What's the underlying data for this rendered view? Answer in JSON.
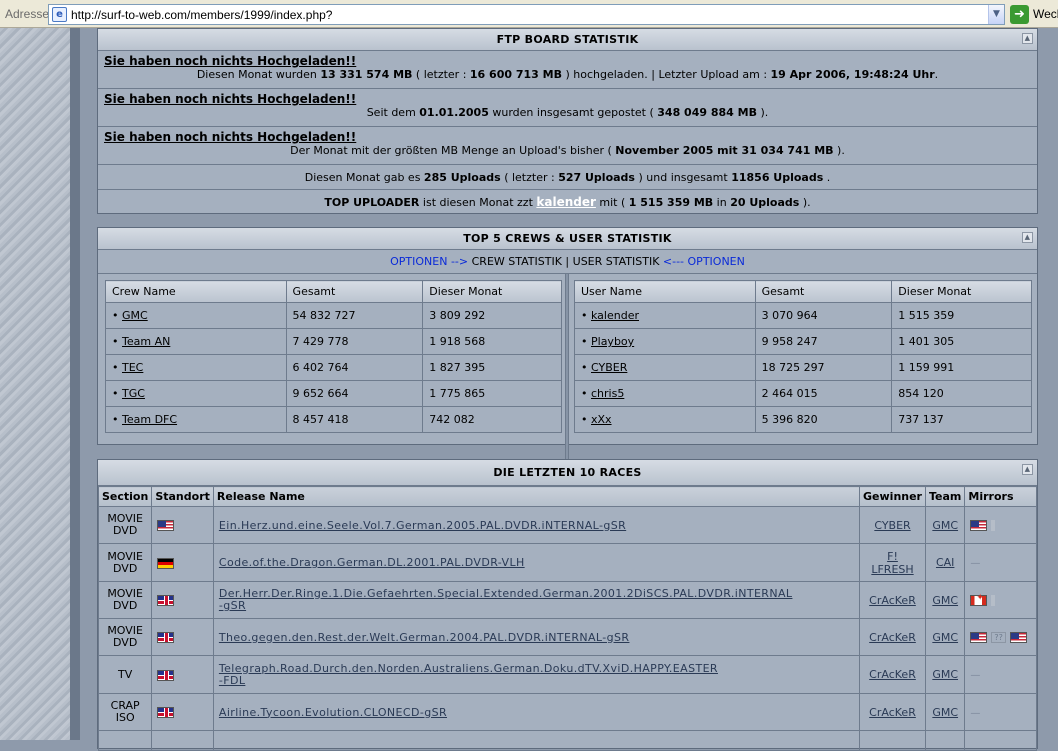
{
  "browser": {
    "address_label": "Adresse",
    "url": "http://surf-to-web.com/members/1999/index.php?",
    "go_label": "Wech"
  },
  "ftp": {
    "title": "FTP BOARD STATISTIK",
    "rows": [
      {
        "link": "Sie haben noch nichts Hochgeladen!!",
        "t1": "Diesen Monat wurden ",
        "b1": "13 331 574 MB",
        "t2": " ( letzter : ",
        "b2": "16 600 713 MB",
        "t3": " ) hochgeladen. | Letzter Upload am : ",
        "b3": "19 Apr 2006, 19:48:24 Uhr",
        "t4": "."
      },
      {
        "link": "Sie haben noch nichts Hochgeladen!!",
        "t1": "Seit dem ",
        "b1": "01.01.2005",
        "t2": " wurden insgesamt gepostet ( ",
        "b2": "348 049 884 MB",
        "t3": " )."
      },
      {
        "link": "Sie haben noch nichts Hochgeladen!!",
        "t1": "Der Monat mit der größten MB Menge an Upload's bisher ( ",
        "b1": "November 2005 mit 31 034 741 MB",
        "t2": " )."
      }
    ],
    "uploads": {
      "t1": "Diesen Monat gab es ",
      "b1": "285 Uploads",
      "t2": " ( letzter : ",
      "b2": "527 Uploads",
      "t3": " ) und insgesamt ",
      "b3": "11856 Uploads",
      "t4": " ."
    },
    "top": {
      "b1": "TOP UPLOADER",
      "t1": " ist diesen Monat zzt ",
      "link": "kalender",
      "t2": " mit ( ",
      "b2": "1 515 359 MB",
      "t3": " in ",
      "b3": "20 Uploads",
      "t4": " )."
    }
  },
  "top5": {
    "title": "TOP 5 CREWS & USER STATISTIK",
    "options_left": "OPTIONEN -->",
    "crew_label": "CREW STATISTIK",
    "sep": "|",
    "user_label": "USER STATISTIK",
    "options_right": "<--- OPTIONEN",
    "crew_headers": [
      "Crew Name",
      "Gesamt",
      "Dieser Monat"
    ],
    "crews": [
      {
        "name": "GMC",
        "total": "54 832 727",
        "month": "3 809 292"
      },
      {
        "name": "Team AN",
        "total": "7 429 778",
        "month": "1 918 568"
      },
      {
        "name": "TEC",
        "total": "6 402 764",
        "month": "1 827 395"
      },
      {
        "name": "TGC",
        "total": "9 652 664",
        "month": "1 775 865"
      },
      {
        "name": "Team DFC",
        "total": "8 457 418",
        "month": "742 082"
      }
    ],
    "user_headers": [
      "User Name",
      "Gesamt",
      "Dieser Monat"
    ],
    "users": [
      {
        "name": "kalender",
        "total": "3 070 964",
        "month": "1 515 359"
      },
      {
        "name": "Playboy",
        "total": "9 958 247",
        "month": "1 401 305"
      },
      {
        "name": "CYBER",
        "total": "18 725 297",
        "month": "1 159 991"
      },
      {
        "name": "chris5",
        "total": "2 464 015",
        "month": "854 120"
      },
      {
        "name": "xXx",
        "total": "5 396 820",
        "month": "737 137"
      }
    ]
  },
  "races": {
    "title": "DIE LETZTEN 10 RACES",
    "headers": [
      "Section",
      "Standort",
      "Release Name",
      "Gewinner",
      "Team",
      "Mirrors"
    ],
    "rows": [
      {
        "sec1": "MOVIE",
        "sec2": "DVD",
        "flag": "us",
        "rel1": "Ein.Herz.und.eine.Seele.Vol.7.German.2005.PAL.DVDR.iNTERNAL-gSR",
        "rel2": "",
        "w1": "CYBER",
        "w2": "",
        "team": "GMC",
        "mirrors": [
          "us"
        ]
      },
      {
        "sec1": "MOVIE",
        "sec2": "DVD",
        "flag": "de",
        "rel1": "Code.of.the.Dragon.German.DL.2001.PAL.DVDR-VLH",
        "rel2": "",
        "w1": "F!",
        "w2": "LFRESH",
        "team": "CAI",
        "mirrors": []
      },
      {
        "sec1": "MOVIE",
        "sec2": "DVD",
        "flag": "uk",
        "rel1": "Der.Herr.Der.Ringe.1.Die.Gefaehrten.Special.Extended.German.2001.2DiSCS.PAL.DVDR.iNTERNAL",
        "rel2": "-gSR",
        "w1": "CrAcKeR",
        "w2": "",
        "team": "GMC",
        "mirrors": [
          "ca"
        ]
      },
      {
        "sec1": "MOVIE",
        "sec2": "DVD",
        "flag": "uk",
        "rel1": "Theo.gegen.den.Rest.der.Welt.German.2004.PAL.DVDR.iNTERNAL-gSR",
        "rel2": "",
        "w1": "CrAcKeR",
        "w2": "",
        "team": "GMC",
        "mirrors": [
          "us",
          "q",
          "us"
        ]
      },
      {
        "sec1": "TV",
        "sec2": "",
        "flag": "uk",
        "rel1": "Telegraph.Road.Durch.den.Norden.Australiens.German.Doku.dTV.XviD.HAPPY.EASTER",
        "rel2": "-FDL",
        "w1": "CrAcKeR",
        "w2": "",
        "team": "GMC",
        "mirrors": []
      },
      {
        "sec1": "CRAP",
        "sec2": "ISO",
        "flag": "uk",
        "rel1": "Airline.Tycoon.Evolution.CLONECD-gSR",
        "rel2": "",
        "w1": "CrAcKeR",
        "w2": "",
        "team": "GMC",
        "mirrors": []
      }
    ]
  }
}
